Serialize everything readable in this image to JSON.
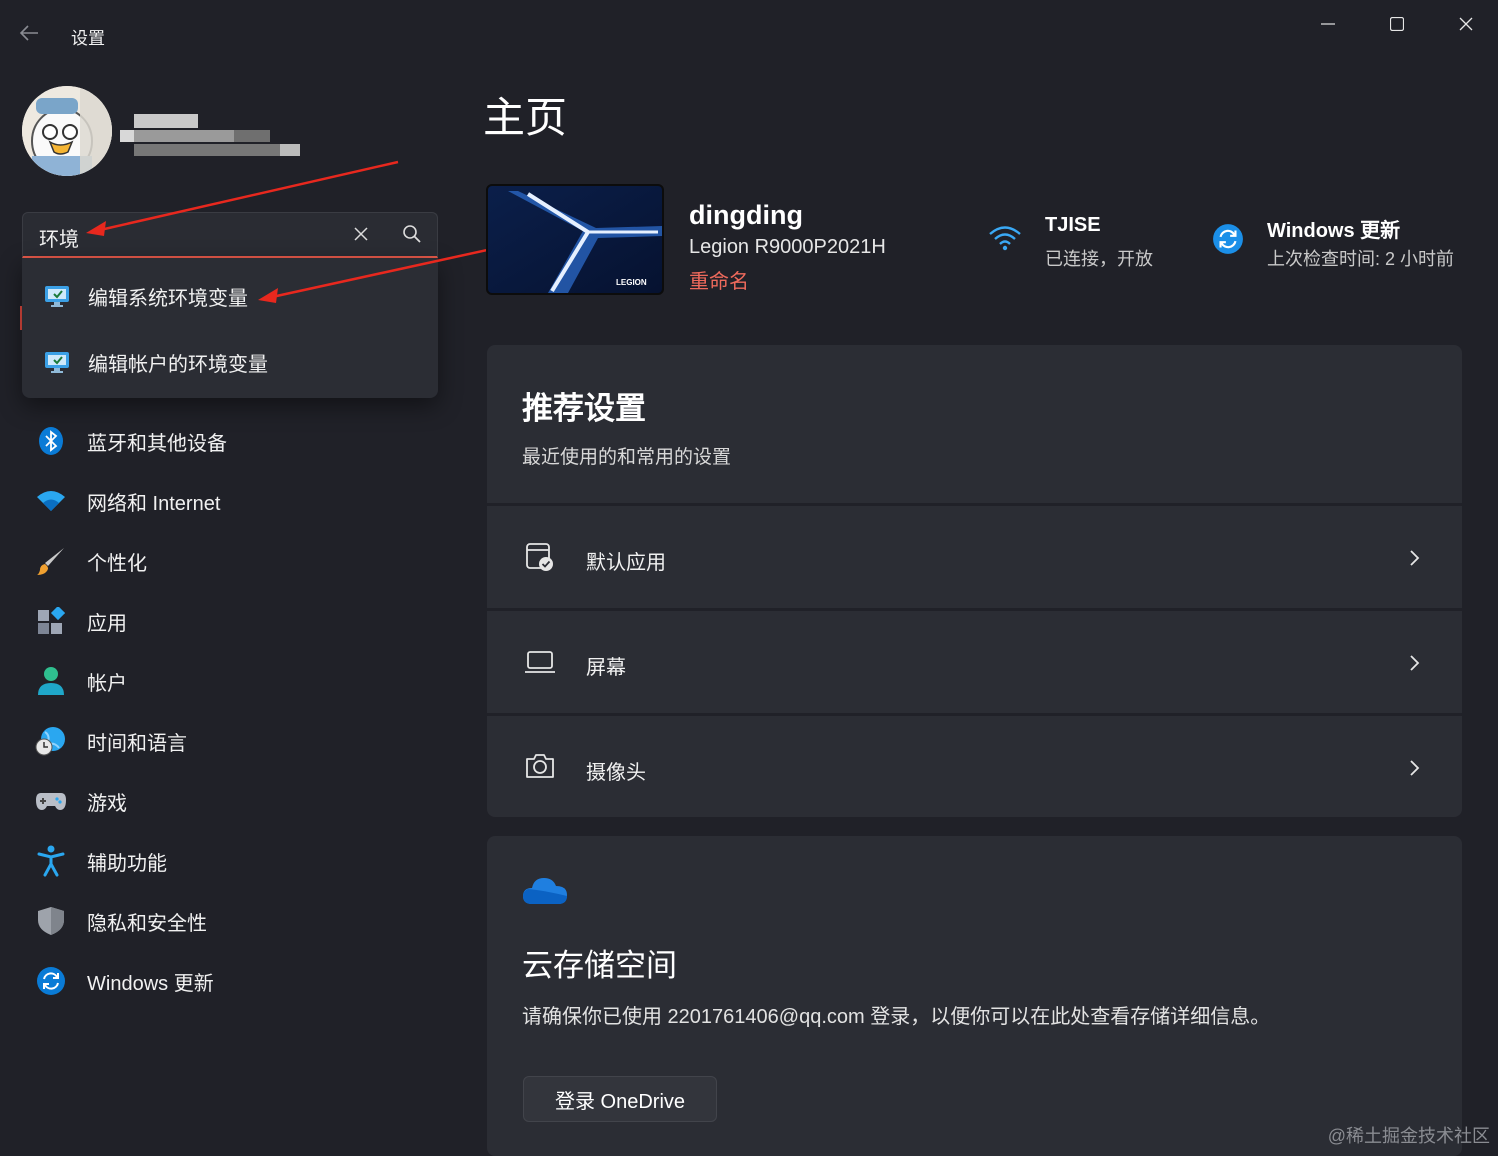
{
  "window": {
    "title": "设置",
    "controls": {
      "minimize": "minimize-icon",
      "maximize": "maximize-icon",
      "close": "close-icon"
    }
  },
  "search": {
    "value": "环境",
    "results": [
      {
        "label": "编辑系统环境变量",
        "icon": "system-env-icon"
      },
      {
        "label": "编辑帐户的环境变量",
        "icon": "account-env-icon"
      }
    ]
  },
  "sidebar": {
    "items": [
      {
        "label": "蓝牙和其他设备",
        "icon": "bluetooth-icon"
      },
      {
        "label": "网络和 Internet",
        "icon": "wifi-icon"
      },
      {
        "label": "个性化",
        "icon": "brush-icon"
      },
      {
        "label": "应用",
        "icon": "apps-icon"
      },
      {
        "label": "帐户",
        "icon": "account-icon"
      },
      {
        "label": "时间和语言",
        "icon": "globe-clock-icon"
      },
      {
        "label": "游戏",
        "icon": "gamepad-icon"
      },
      {
        "label": "辅助功能",
        "icon": "accessibility-icon"
      },
      {
        "label": "隐私和安全性",
        "icon": "shield-icon"
      },
      {
        "label": "Windows 更新",
        "icon": "update-icon"
      }
    ]
  },
  "main": {
    "title": "主页",
    "device": {
      "name": "dingding",
      "model": "Legion R9000P2021H",
      "rename": "重命名",
      "logo_text": "LEGION"
    },
    "network": {
      "title": "TJISE",
      "status": "已连接，开放"
    },
    "update": {
      "title": "Windows 更新",
      "status": "上次检查时间: 2 小时前"
    },
    "recommended": {
      "title": "推荐设置",
      "subtitle": "最近使用的和常用的设置",
      "items": [
        {
          "label": "默认应用",
          "icon": "default-apps-icon"
        },
        {
          "label": "屏幕",
          "icon": "laptop-icon"
        },
        {
          "label": "摄像头",
          "icon": "camera-icon"
        }
      ]
    },
    "cloud": {
      "title": "云存储空间",
      "message": "请确保你已使用 2201761406@qq.com 登录，以便你可以在此处查看存储详细信息。",
      "button": "登录 OneDrive"
    }
  },
  "watermark": "@稀土掘金技术社区",
  "colors": {
    "background": "#202128",
    "card": "#2b2d34",
    "accent_red": "#e7594a",
    "accent_blue": "#0a7bd6"
  }
}
